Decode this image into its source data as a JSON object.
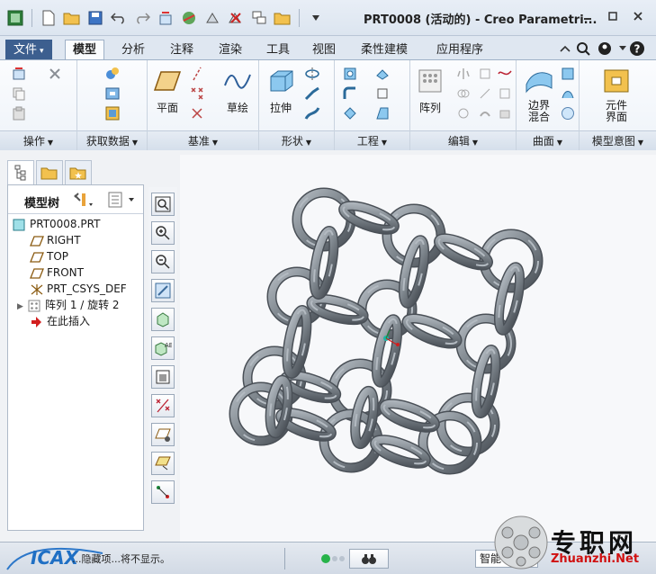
{
  "window": {
    "title": "PRT0008 (活动的) - Creo Parametri..."
  },
  "ribbon_tabs": [
    {
      "label": "文件",
      "dropdown": "▾"
    },
    {
      "label": "模型",
      "active": true
    },
    {
      "label": "分析"
    },
    {
      "label": "注释"
    },
    {
      "label": "渲染"
    },
    {
      "label": "工具"
    },
    {
      "label": "视图"
    },
    {
      "label": "柔性建模"
    },
    {
      "label": "应用程序"
    }
  ],
  "ribbon_groups": {
    "operations": {
      "label": "操作"
    },
    "get_data": {
      "label": "获取数据"
    },
    "datum": {
      "label": "基准",
      "plane": "平面",
      "sketch": "草绘"
    },
    "shapes": {
      "label": "形状",
      "extrude": "拉伸"
    },
    "engineering": {
      "label": "工程"
    },
    "editing": {
      "label": "编辑",
      "pattern": "阵列"
    },
    "surfaces": {
      "label": "曲面",
      "boundary_blend": "边界\n混合"
    },
    "model_intent": {
      "label": "模型意图",
      "component_interface": "元件\n界面"
    }
  },
  "model_tree": {
    "header": "模型树",
    "items": [
      {
        "label": "PRT0008.PRT",
        "icon": "part-icon"
      },
      {
        "label": "RIGHT",
        "icon": "datum-plane-icon"
      },
      {
        "label": "TOP",
        "icon": "datum-plane-icon"
      },
      {
        "label": "FRONT",
        "icon": "datum-plane-icon"
      },
      {
        "label": "PRT_CSYS_DEF",
        "icon": "csys-icon"
      },
      {
        "label": "阵列 1 / 旋转 2",
        "icon": "pattern-icon",
        "expandable": true
      },
      {
        "label": "在此插入",
        "icon": "insert-here-arrow-icon"
      }
    ]
  },
  "status": {
    "message": "...隐藏项...将不显示。",
    "smart_filter": "智能"
  },
  "watermark": {
    "logo": "ICAX",
    "cn": "专职网",
    "url": "Zhuanzhi.Net"
  },
  "colors": {
    "ring_fill": "#7d858c",
    "ring_highlight": "#b3bac1",
    "ring_shadow": "#4a5057",
    "accent_blue": "#1f6fc4"
  }
}
